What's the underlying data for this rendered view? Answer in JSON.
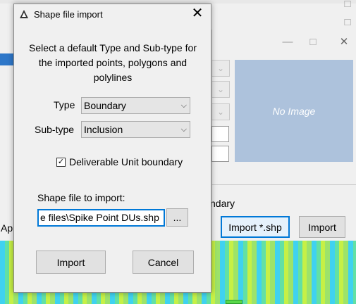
{
  "background_app": {
    "titlebar_buttons": [
      "□",
      "□"
    ],
    "window_buttons": {
      "minimize": "—",
      "maximize": "□",
      "close": "✕"
    },
    "no_image_text": "No Image",
    "checkbox_label_partial": "ndary",
    "import_shp_button": "Import *.shp",
    "import_button": "Import",
    "left_label_partial": "Ap"
  },
  "dialog": {
    "title": "Shape file import",
    "close_symbol": "✕",
    "instruction": "Select a default Type and Sub-type for the imported points, polygons and polylines",
    "type_label": "Type",
    "type_value": "Boundary",
    "subtype_label": "Sub-type",
    "subtype_value": "Inclusion",
    "checkbox_label": "Deliverable Unit boundary",
    "checkbox_checked": true,
    "shapefile_label": "Shape file to import:",
    "shapefile_value": "e files\\Spike Point DUs.shp",
    "browse_label": "...",
    "import_label": "Import",
    "cancel_label": "Cancel"
  },
  "colors": {
    "accent": "#0078d7",
    "no_image_bg": "#adc2dc"
  }
}
